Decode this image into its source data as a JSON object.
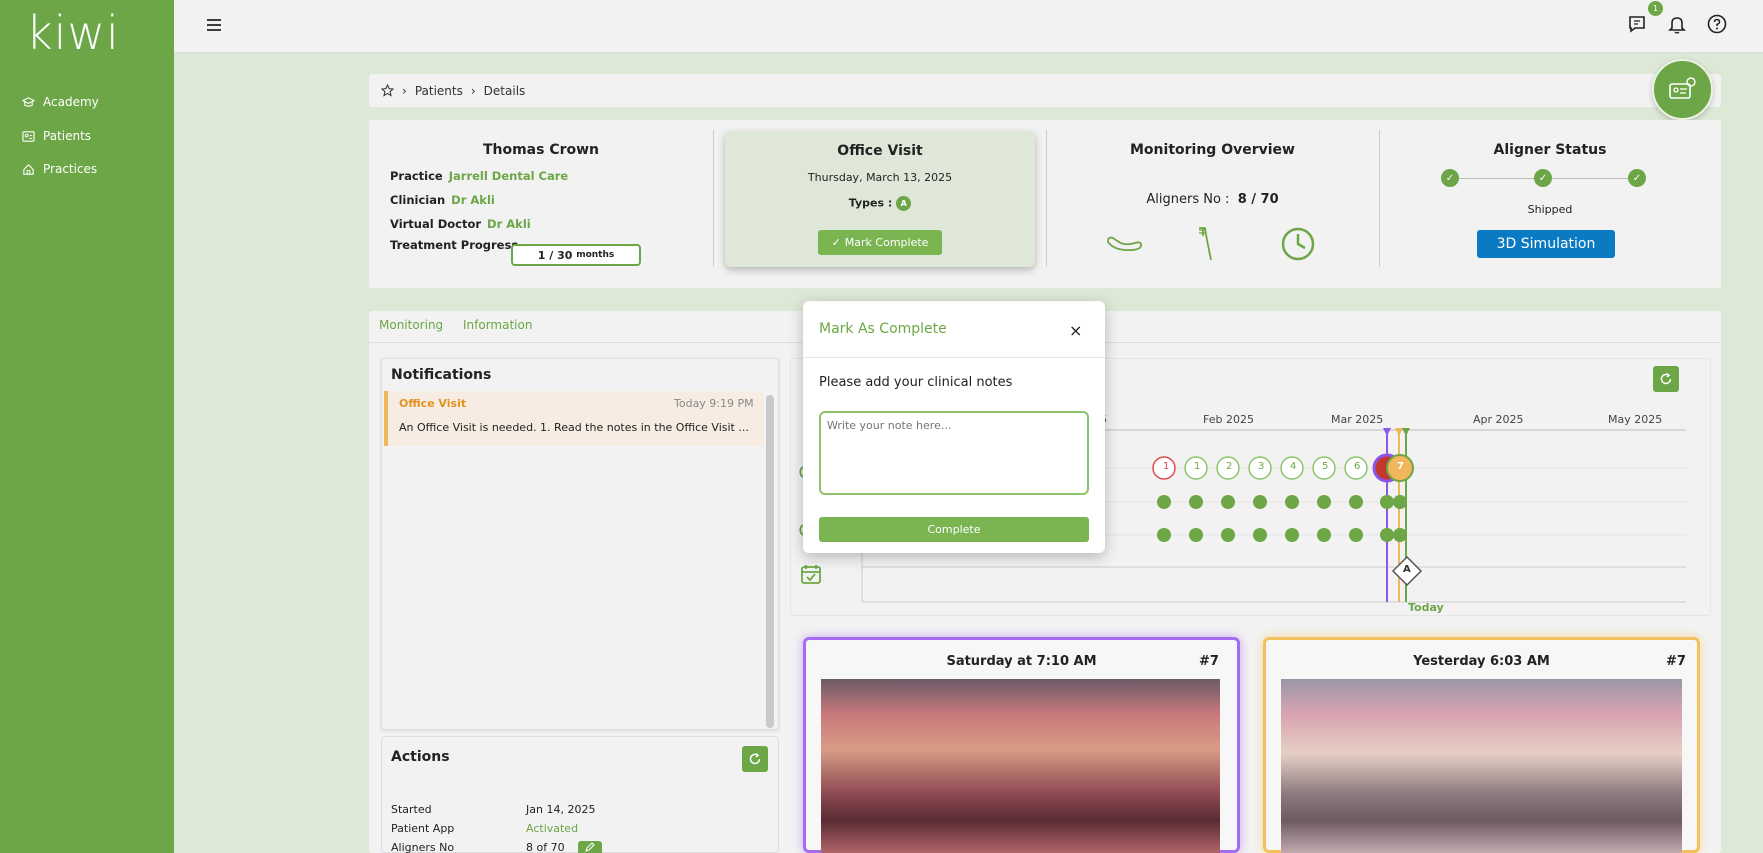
{
  "app": {
    "logo": "kiwi"
  },
  "sidebar": {
    "items": [
      {
        "label": "Academy",
        "icon": "academy-icon"
      },
      {
        "label": "Patients",
        "icon": "patients-icon"
      },
      {
        "label": "Practices",
        "icon": "practices-icon"
      }
    ]
  },
  "topbar": {
    "chat_badge": "1"
  },
  "breadcrumb": {
    "items": [
      "Patients",
      "Details"
    ]
  },
  "patient": {
    "name": "Thomas Crown",
    "practice_label": "Practice",
    "practice": "Jarrell Dental Care",
    "clinician_label": "Clinician",
    "clinician": "Dr Akli",
    "virtual_doctor_label": "Virtual Doctor",
    "virtual_doctor": "Dr Akli",
    "progress_label": "Treatment Progress",
    "progress_value": "1 / 30",
    "progress_unit": "months",
    "progress_fraction": 0.97
  },
  "office_visit": {
    "title": "Office Visit",
    "date": "Thursday, March 13, 2025",
    "types_label": "Types :",
    "type_badge": "A",
    "mark_button": "Mark Complete"
  },
  "monitoring": {
    "title": "Monitoring Overview",
    "aligners_label": "Aligners No :",
    "aligners_value": "8 / 70"
  },
  "aligner_status": {
    "title": "Aligner Status",
    "step_label": "Shipped",
    "simulation_button": "3D Simulation"
  },
  "tabs": [
    {
      "label": "Monitoring"
    },
    {
      "label": "Information"
    }
  ],
  "notifications": {
    "title": "Notifications",
    "items": [
      {
        "title": "Office Visit",
        "time": "Today 9:19 PM",
        "text": "An Office Visit is needed. 1. Read the notes in the Office Visit ..."
      }
    ]
  },
  "actions": {
    "title": "Actions",
    "rows": [
      {
        "label": "Started",
        "value": "Jan 14, 2025"
      },
      {
        "label": "Patient App",
        "value": "Activated"
      },
      {
        "label": "Aligners No",
        "value": "8 of 70"
      }
    ]
  },
  "timeline": {
    "months": [
      "5",
      "Feb 2025",
      "Mar 2025",
      "Apr 2025",
      "May 2025"
    ],
    "circles": [
      "1",
      "1",
      "2",
      "3",
      "4",
      "5",
      "6"
    ],
    "current": "7",
    "marker": "A",
    "today_label": "Today"
  },
  "photos": [
    {
      "title": "Saturday at 7:10 AM",
      "number": "#7"
    },
    {
      "title": "Yesterday 6:03 AM",
      "number": "#7"
    }
  ],
  "modal": {
    "title": "Mark As Complete",
    "close": "×",
    "label": "Please add your clinical notes",
    "placeholder": "Write your note here...",
    "button": "Complete"
  },
  "colors": {
    "brand": "#6ca646",
    "accent_blue": "#0a7ac2",
    "highlight_orange": "#f2b65d",
    "highlight_purple": "#a56bf0"
  }
}
